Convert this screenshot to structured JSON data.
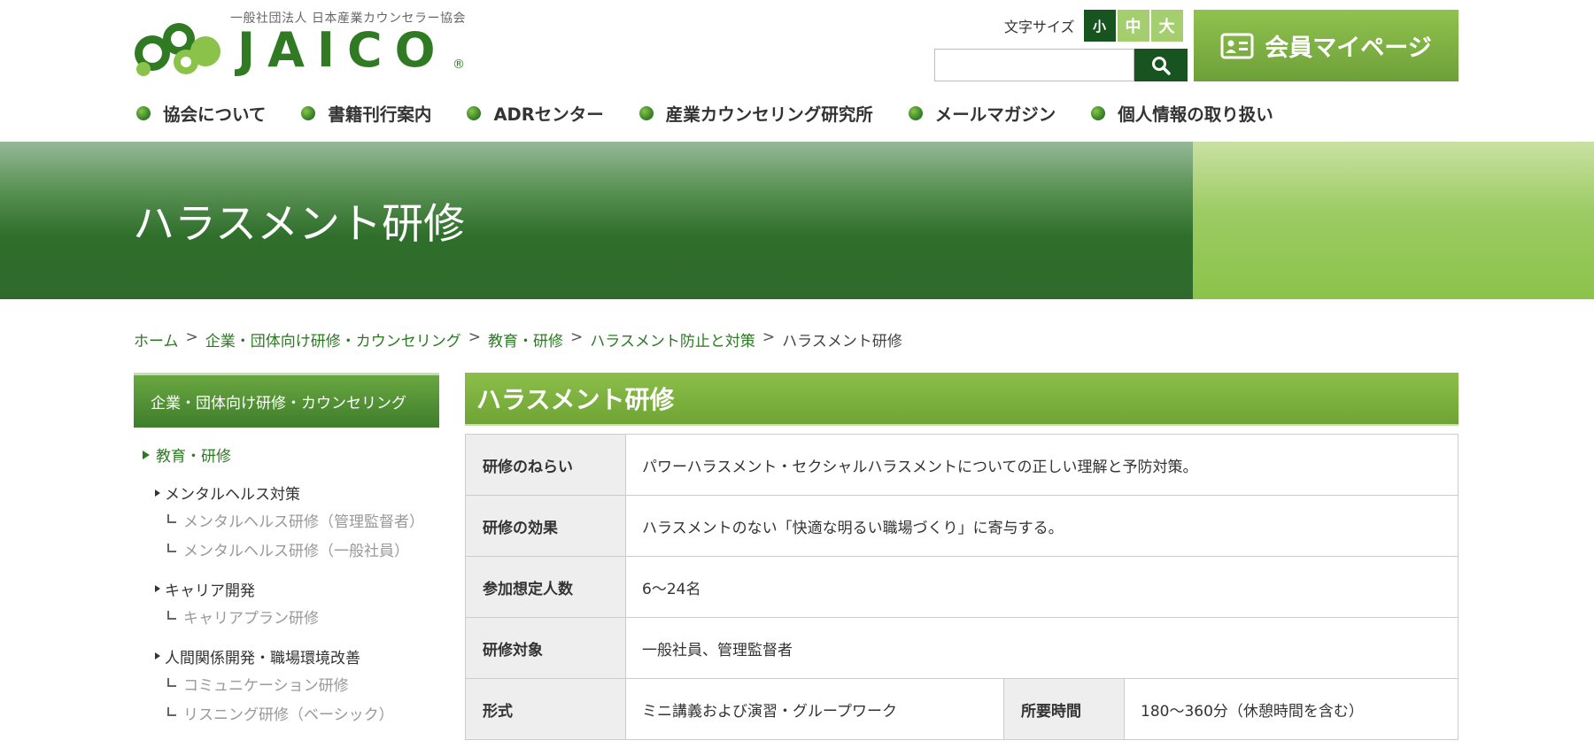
{
  "header": {
    "logo_org": "一般社団法人 日本産業カウンセラー協会",
    "logo_name": "JAICO",
    "logo_reg": "®",
    "font_size_label": "文字サイズ",
    "font_sizes": [
      "小",
      "中",
      "大"
    ],
    "search_placeholder": "",
    "member_button": "会員マイページ"
  },
  "nav": {
    "items": [
      "協会について",
      "書籍刊行案内",
      "ADRセンター",
      "産業カウンセリング研究所",
      "メールマガジン",
      "個人情報の取り扱い"
    ]
  },
  "banner": {
    "title": "ハラスメント研修"
  },
  "breadcrumb": {
    "items": [
      "ホーム",
      "企業・団体向け研修・カウンセリング",
      "教育・研修",
      "ハラスメント防止と対策"
    ],
    "separator": ">",
    "current": "ハラスメント研修"
  },
  "sidebar": {
    "heading": "企業・団体向け研修・カウンセリング",
    "level1": "教育・研修",
    "groups": [
      {
        "label": "メンタルヘルス対策",
        "children": [
          "メンタルヘルス研修（管理監督者）",
          "メンタルヘルス研修（一般社員）"
        ]
      },
      {
        "label": "キャリア開発",
        "children": [
          "キャリアプラン研修"
        ]
      },
      {
        "label": "人間関係開発・職場環境改善",
        "children": [
          "コミュニケーション研修",
          "リスニング研修（ベーシック）"
        ]
      }
    ]
  },
  "main": {
    "title": "ハラスメント研修",
    "rows": [
      {
        "label": "研修のねらい",
        "value": "パワーハラスメント・セクシャルハラスメントについての正しい理解と予防対策。"
      },
      {
        "label": "研修の効果",
        "value": "ハラスメントのない「快適な明るい職場づくり」に寄与する。"
      },
      {
        "label": "参加想定人数",
        "value": "6〜24名"
      },
      {
        "label": "研修対象",
        "value": "一般社員、管理監督者"
      }
    ],
    "format_row": {
      "label": "形式",
      "value": "ミニ講義および演習・グループワーク",
      "label2": "所要時間",
      "value2": "180〜360分（休憩時間を含む）"
    }
  },
  "colors": {
    "dark_green": "#17541f",
    "green": "#6fa335",
    "light_green": "#a5cf6f",
    "link": "#2b7a22"
  }
}
